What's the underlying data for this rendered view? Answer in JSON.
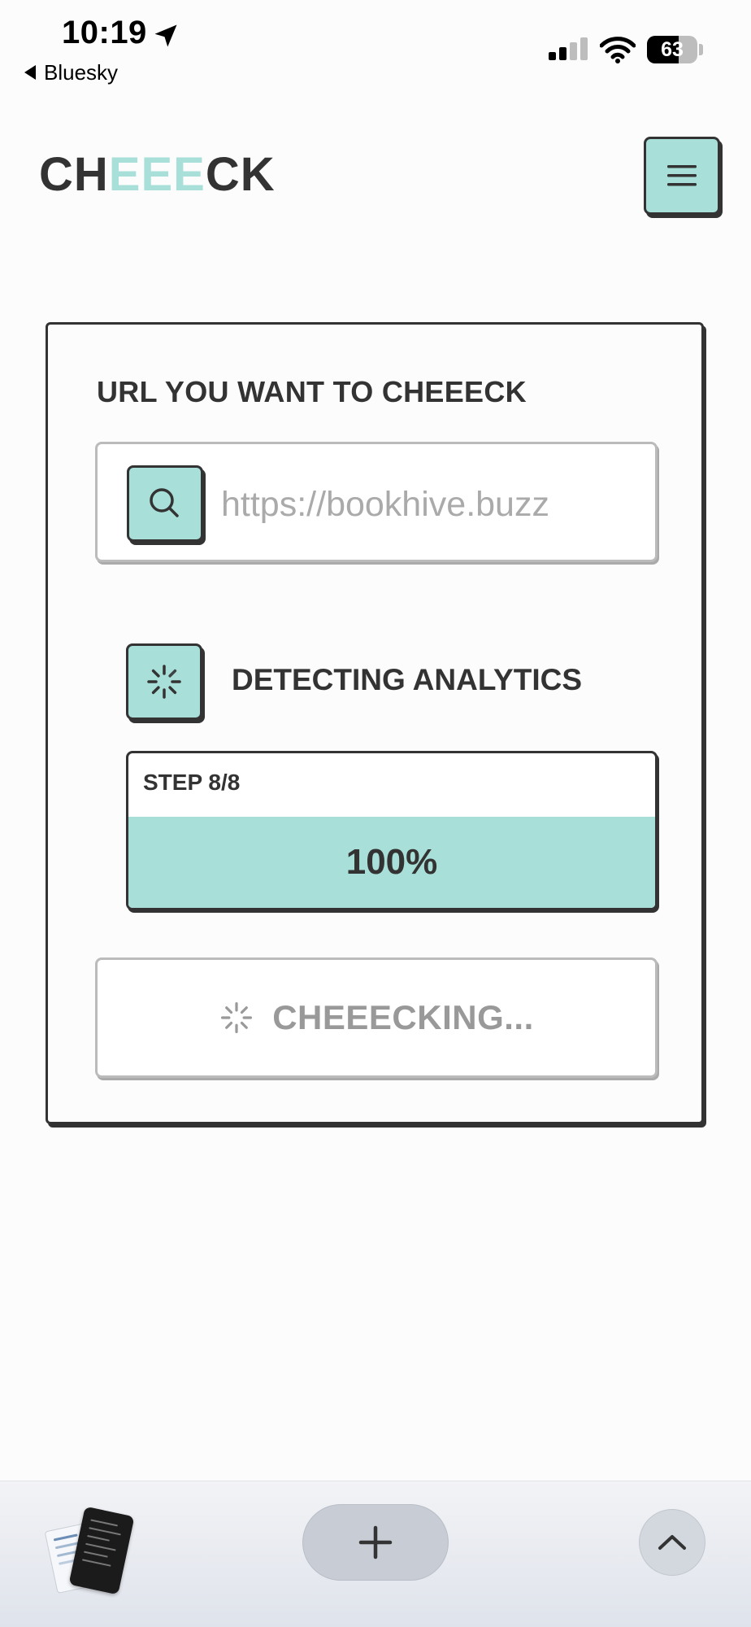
{
  "status_bar": {
    "time": "10:19",
    "back_app": "Bluesky",
    "battery_level": "63",
    "icons": [
      "location-arrow-icon",
      "signal-icon",
      "wifi-icon",
      "battery-icon"
    ]
  },
  "header": {
    "logo_parts": [
      "CH",
      "EEE",
      "CK"
    ],
    "menu_icon": "hamburger-menu-icon"
  },
  "form": {
    "label": "URL YOU WANT TO CHEEECK",
    "url_placeholder": "https://bookhive.buzz",
    "url_value": "",
    "search_icon": "search-icon"
  },
  "progress": {
    "status": "DETECTING ANALYTICS",
    "step": "STEP 8/8",
    "percent_label": "100%",
    "percent": 100
  },
  "submit": {
    "label": "CHEEECKING...",
    "state": "loading"
  },
  "browser_toolbar": {
    "icons": [
      "tabs-overview-icon",
      "plus-icon",
      "chevron-up-icon"
    ]
  },
  "colors": {
    "accent": "#a8dfd8",
    "ink": "#333333",
    "muted": "#999999",
    "background": "#fcfcfc"
  }
}
